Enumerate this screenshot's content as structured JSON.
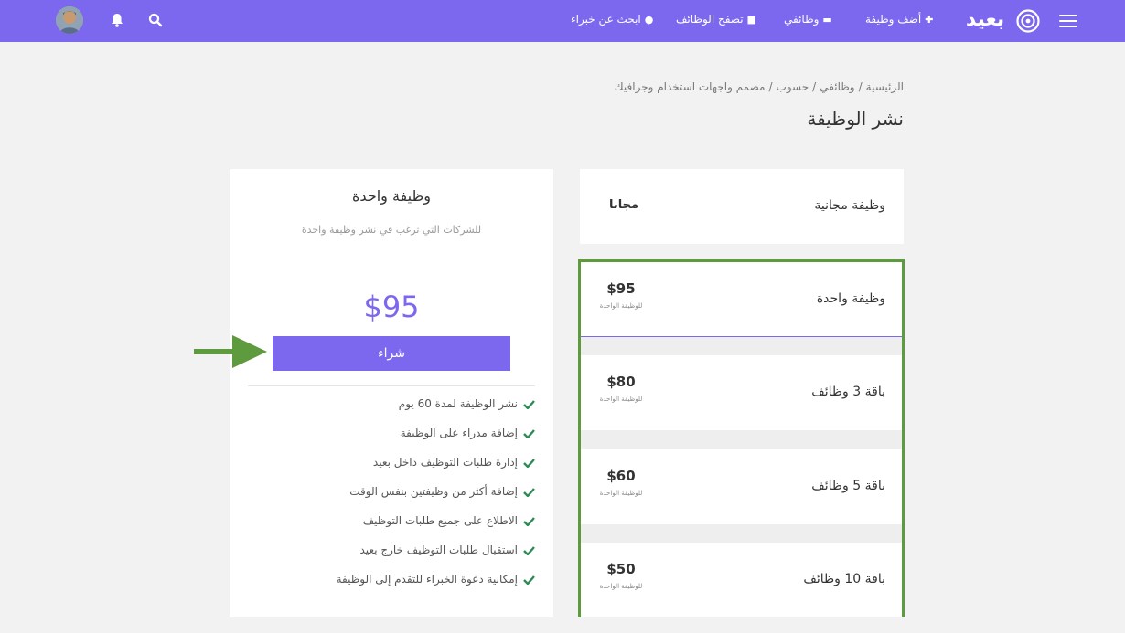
{
  "nav": {
    "logo_text": "بعيد",
    "links": [
      {
        "label": "أضف وظيفة",
        "icon": "plus-icon"
      },
      {
        "label": "وظائفي",
        "icon": "folder-icon"
      },
      {
        "label": "تصفح الوظائف",
        "icon": "briefcase-icon"
      },
      {
        "label": "ابحث عن خبراء",
        "icon": "users-icon"
      }
    ]
  },
  "breadcrumb": [
    "الرئيسية",
    "وظائفي",
    "حسوب",
    "مصمم واجهات استخدام وجرافيك"
  ],
  "page_title": "نشر الوظيفة",
  "selected_plan": {
    "title": "وظيفة واحدة",
    "subtitle": "للشركات التي ترغب في نشر وظيفة واحدة",
    "price": "$95",
    "buy_label": "شراء",
    "features": [
      "نشر الوظيفة لمدة 60 يوم",
      "إضافة مدراء على الوظيفة",
      "إدارة طلبات التوظيف داخل بعيد",
      "إضافة أكثر من وظيفتين بنفس الوقت",
      "الاطلاع على جميع طلبات التوظيف",
      "استقبال طلبات التوظيف خارج بعيد",
      "إمكانية دعوة الخبراء للتقدم إلى الوظيفة"
    ]
  },
  "free_plan": {
    "label": "وظيفة مجانية",
    "price": "مجانا"
  },
  "plans": [
    {
      "label": "وظيفة واحدة",
      "price": "$95",
      "per": "للوظيفة الواحدة"
    },
    {
      "label": "باقة 3 وظائف",
      "price": "$80",
      "per": "للوظيفة الواحدة"
    },
    {
      "label": "باقة 5 وظائف",
      "price": "$60",
      "per": "للوظيفة الواحدة"
    },
    {
      "label": "باقة 10 وظائف",
      "price": "$50",
      "per": "للوظيفة الواحدة"
    }
  ],
  "colors": {
    "accent": "#7b68ee",
    "highlight": "#5e9a3e",
    "check": "#2e8b57"
  }
}
